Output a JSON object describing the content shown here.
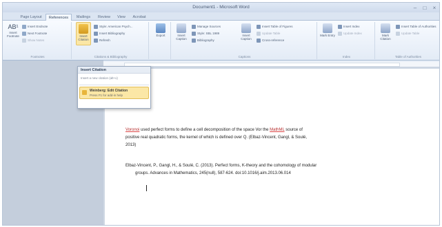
{
  "window": {
    "title": "Document1 - Microsoft Word"
  },
  "tabs": [
    "Page Layout",
    "References",
    "Mailings",
    "Review",
    "View",
    "Acrobat"
  ],
  "ribbon": {
    "toc_group": {
      "big_label": "Insert Footnote",
      "small": [
        "Insert Endnote",
        "Next Footnote",
        "Show Notes"
      ],
      "label": "Footnotes"
    },
    "citations_group": {
      "insert_citation": "Insert Citation",
      "style_label": "Style: American Psych...",
      "insert_bibliography": "Insert Bibliography",
      "refresh": "Refresh",
      "label": "Citations & Bibliography"
    },
    "export": "Export",
    "captions": {
      "insert_caption": "Insert Caption",
      "manage_sources": "Manage Sources",
      "style": "Style: SBL 1989",
      "bibliography": "Bibliography",
      "insert_table_figures": "Insert Table of Figures",
      "update_table": "Update Table",
      "cross_reference": "Cross-reference",
      "label": "Captions"
    },
    "index": {
      "mark_entry": "Mark Entry",
      "insert_index": "Insert Index",
      "update_index": "Update Index",
      "label": "Index"
    },
    "authorities": {
      "mark_citation": "Mark Citation",
      "insert_table": "Insert Table of Authorities",
      "update_table": "Update Table",
      "label": "Table of Authorities"
    }
  },
  "dropdown": {
    "header": "Insert Citation",
    "subtitle": "Insert a new citation (alt+x)",
    "item_name": "Weinberg: Edit Citation",
    "item_desc": "Press F1 for add-in help"
  },
  "document": {
    "para1_red": "Voronoi",
    "para1_line1": " used perfect forms to define a cell decomposition of the space Vor the ",
    "para1_red2": "MathML",
    "para1_line1_end": " source of",
    "para1_line2": "positive real quadratic forms, the kernel of which is defined over Q. (Elbaz-Vincent, Gangl, & Soulé,",
    "para1_line3": "2013)",
    "ref_line1": "Elbaz-Vincent, P., Gangl, H., & Soulé, C. (2013). Perfect forms, K-theory and the cohomology of modular",
    "ref_line2": "groups. Advances in Mathematics, 245(null), 587-624. doi:10.1016/j.aim.2013.06.014"
  }
}
